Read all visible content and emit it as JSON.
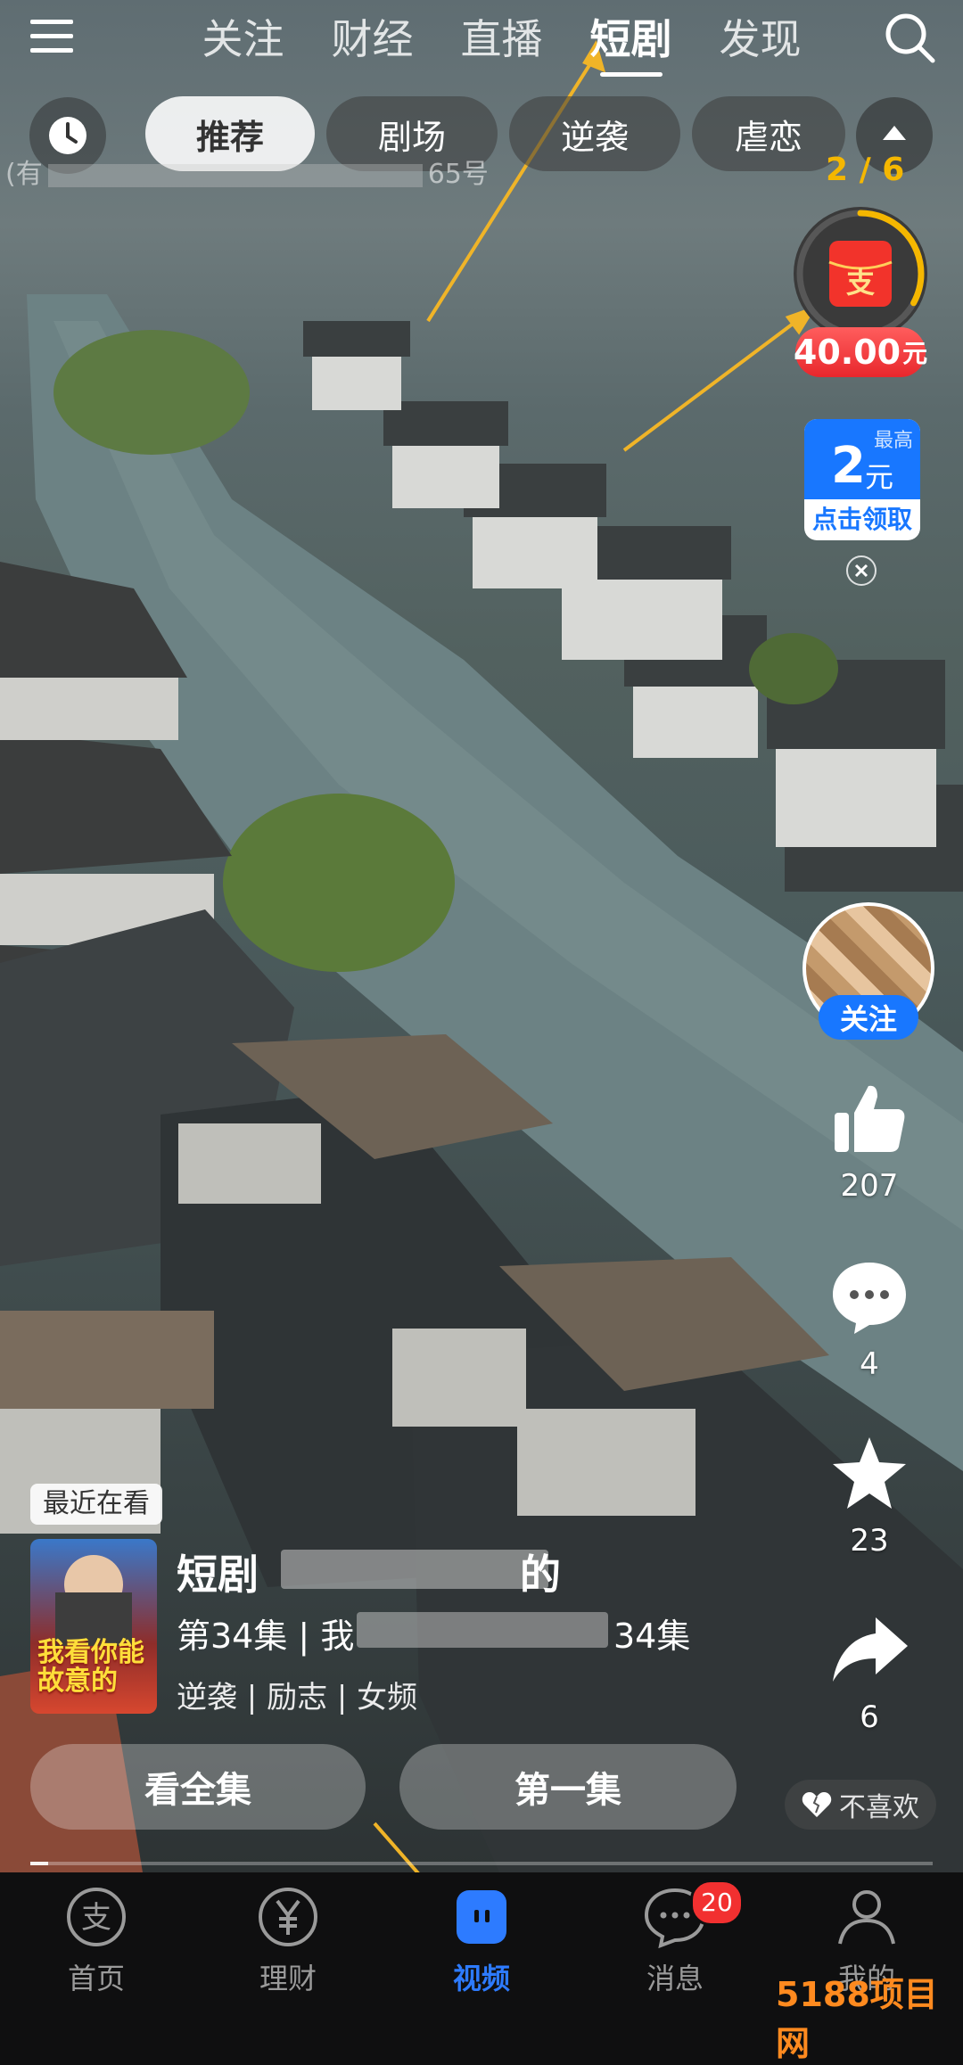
{
  "top_nav": {
    "tabs": [
      {
        "label": "关注",
        "active": false
      },
      {
        "label": "财经",
        "active": false
      },
      {
        "label": "直播",
        "active": false
      },
      {
        "label": "短剧",
        "active": true
      },
      {
        "label": "发现",
        "active": false
      }
    ]
  },
  "categories": {
    "chips": [
      {
        "label": "推荐",
        "active": true
      },
      {
        "label": "剧场",
        "active": false
      },
      {
        "label": "逆袭",
        "active": false
      },
      {
        "label": "虐恋",
        "active": false
      }
    ]
  },
  "watermark": {
    "prefix": "(有",
    "suffix": "65号"
  },
  "reward": {
    "progress_text": "2 / 6",
    "amount": "40.00",
    "unit": "元",
    "progress_fraction": 0.33
  },
  "coupon": {
    "max_label": "最高",
    "value": "2",
    "unit": "元",
    "cta": "点击领取"
  },
  "creator": {
    "follow_label": "关注"
  },
  "actions": {
    "likes": "207",
    "comments": "4",
    "favorites": "23",
    "shares": "6",
    "dislike_label": "不喜欢"
  },
  "drama": {
    "recent_badge": "最近在看",
    "title_prefix": "短剧",
    "title_suffix": "的",
    "episode_prefix": "第34集 | 我",
    "episode_suffix": "34集",
    "tags": "逆袭 | 励志 | 女频",
    "poster_text": "我看你能 故意的",
    "watch_all": "看全集",
    "first_episode": "第一集",
    "playback_progress": 0.02
  },
  "bottom_tabs": [
    {
      "label": "首页",
      "icon": "alipay-home-icon",
      "active": false
    },
    {
      "label": "理财",
      "icon": "yuan-icon",
      "active": false
    },
    {
      "label": "视频",
      "icon": "video-icon",
      "active": true
    },
    {
      "label": "消息",
      "icon": "chat-icon",
      "active": false,
      "badge": "20"
    },
    {
      "label": "我的",
      "icon": "person-icon",
      "active": false
    }
  ],
  "site_watermark": "5188项目网",
  "colors": {
    "accent_blue": "#1877ff",
    "reward_red": "#e8272c",
    "reward_gold": "#f5b700",
    "badge_red": "#f23030",
    "annotation_arrow": "#f0b428"
  }
}
